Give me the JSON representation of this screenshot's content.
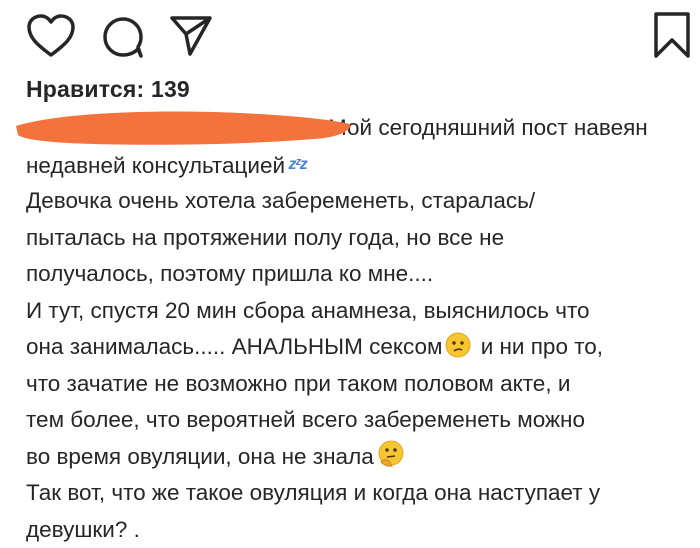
{
  "actions": {
    "like": "heart-icon",
    "comment": "comment-icon",
    "share": "share-icon",
    "save": "bookmark-icon"
  },
  "likes": {
    "text": "Нравится: 139"
  },
  "caption": {
    "line1": "Мой сегодняшний пост навеян",
    "line2": "недавней консультацией",
    "line3": "Девочка очень хотела забеременеть, старалась/",
    "line4": "пыталась на протяжении полу года, но все не",
    "line5": "получалось, поэтому пришла ко мне....",
    "line6": "И тут, спустя 20 мин сбора анамнеза, выяснилось что",
    "line7a": "она занималась..... АНАЛЬНЫМ сексом",
    "line7b": " и ни про то,",
    "line8": "что зачатие не возможно при таком половом акте, и",
    "line9": "тем более, что вероятней всего забеременеть можно",
    "line10": "во время овуляции, она не знала",
    "line11": "Так вот, что же такое овуляция и когда она наступает у",
    "line12": "девушки? ."
  },
  "colors": {
    "redaction": "#f4733c",
    "text": "#262626"
  }
}
